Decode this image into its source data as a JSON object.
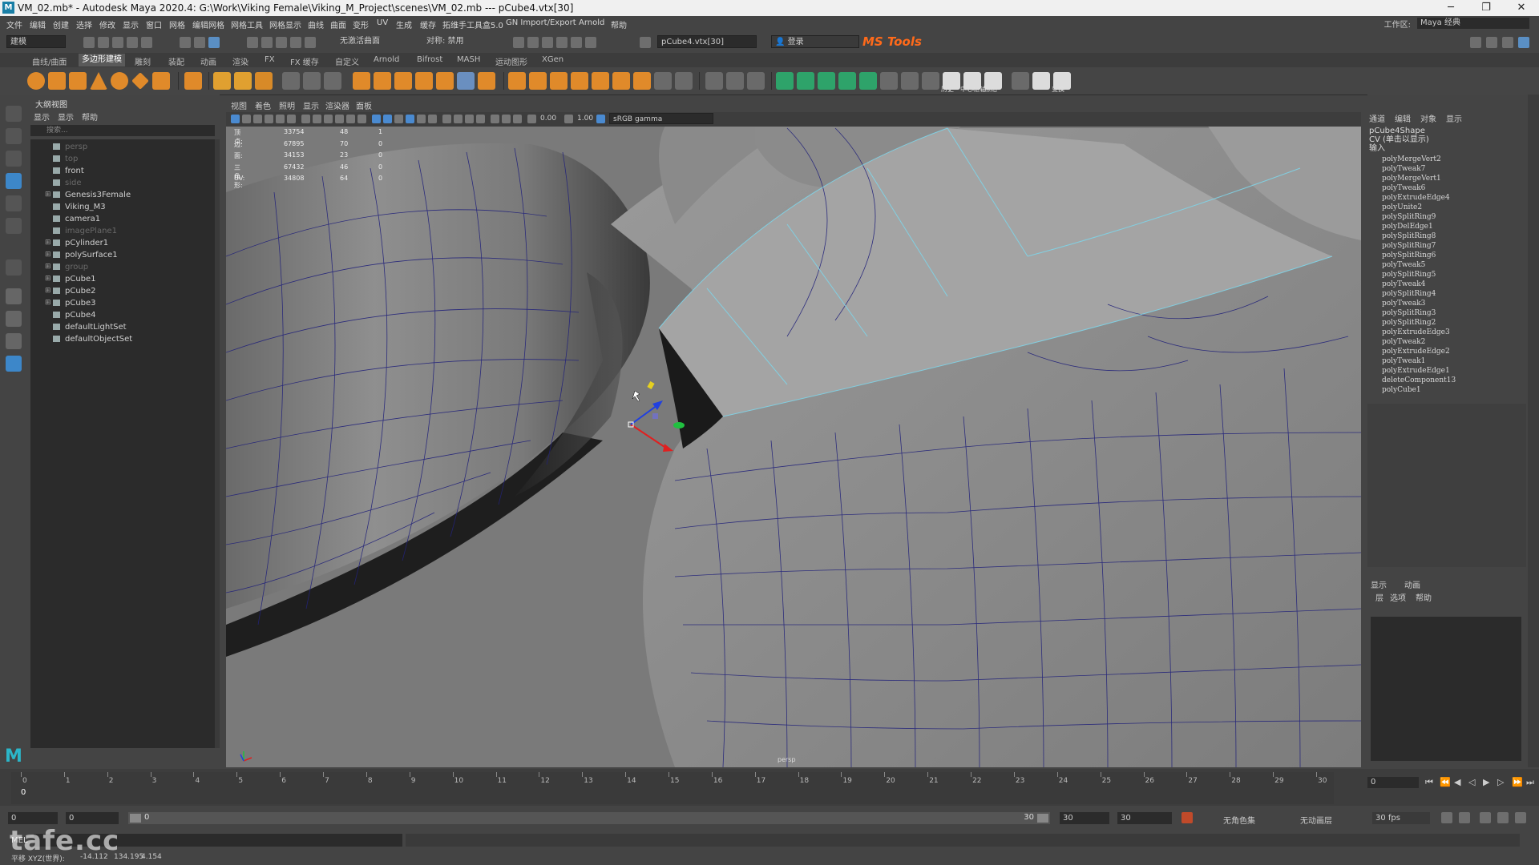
{
  "window": {
    "title": "VM_02.mb* - Autodesk Maya 2020.4: G:\\Work\\Viking Female\\Viking_M_Project\\scenes\\VM_02.mb   ---   pCube4.vtx[30]",
    "minimize": "─",
    "maximize": "❐",
    "close": "✕"
  },
  "menus": [
    "文件",
    "编辑",
    "创建",
    "选择",
    "修改",
    "显示",
    "窗口",
    "网格",
    "编辑网格",
    "网格工具",
    "网格显示",
    "曲线",
    "曲面",
    "变形",
    "UV",
    "生成",
    "缓存",
    "拓维手工具盒5.0",
    "GN Import/Export",
    "Arnold",
    "帮助"
  ],
  "workspace": {
    "label": "工作区:",
    "value": "Maya 经典"
  },
  "status": {
    "mode": "建模",
    "live_surface": "无激活曲面",
    "symmetry": "对称: 禁用",
    "selection_field": "pCube4.vtx[30]",
    "login": "登录",
    "mstools": "MS Tools"
  },
  "shelf_tabs": [
    "曲线/曲面",
    "多边形建模",
    "雕刻",
    "装配",
    "动画",
    "渲染",
    "FX",
    "FX 缓存",
    "自定义",
    "Arnold",
    "Bifrost",
    "MASH",
    "运动图形",
    "XGen"
  ],
  "shelf_active": "多边形建模",
  "shelf_text_labels": [
    "历史",
    "中心枢轴",
    "冻结",
    "变换"
  ],
  "outliner": {
    "title": "大纲视图",
    "menu": [
      "显示",
      "显示",
      "帮助"
    ],
    "search_placeholder": "搜索...",
    "items": [
      {
        "label": "persp",
        "dim": true,
        "expand": ""
      },
      {
        "label": "top",
        "dim": true,
        "expand": ""
      },
      {
        "label": "front",
        "dim": false,
        "expand": ""
      },
      {
        "label": "side",
        "dim": true,
        "expand": ""
      },
      {
        "label": "Genesis3Female",
        "dim": false,
        "expand": "⊞"
      },
      {
        "label": "Viking_M3",
        "dim": false,
        "expand": ""
      },
      {
        "label": "camera1",
        "dim": false,
        "expand": ""
      },
      {
        "label": "imagePlane1",
        "dim": true,
        "expand": ""
      },
      {
        "label": "pCylinder1",
        "dim": false,
        "expand": "⊞"
      },
      {
        "label": "polySurface1",
        "dim": false,
        "expand": "⊞"
      },
      {
        "label": "group",
        "dim": true,
        "expand": "⊞"
      },
      {
        "label": "pCube1",
        "dim": false,
        "expand": "⊞"
      },
      {
        "label": "pCube2",
        "dim": false,
        "expand": "⊞"
      },
      {
        "label": "pCube3",
        "dim": false,
        "expand": "⊞"
      },
      {
        "label": "pCube4",
        "dim": false,
        "expand": ""
      },
      {
        "label": "defaultLightSet",
        "dim": false,
        "expand": ""
      },
      {
        "label": "defaultObjectSet",
        "dim": false,
        "expand": ""
      }
    ]
  },
  "viewport": {
    "menu": [
      "视图",
      "着色",
      "照明",
      "显示",
      "渲染器",
      "面板"
    ],
    "exposure": "0.00",
    "gamma": "1.00",
    "color_space": "sRGB gamma",
    "camera_label": "persp",
    "stats": [
      {
        "label": "顶点:",
        "total": "33754",
        "sel": "48",
        "comp": "1"
      },
      {
        "label": "边:",
        "total": "67895",
        "sel": "70",
        "comp": "0"
      },
      {
        "label": "面:",
        "total": "34153",
        "sel": "23",
        "comp": "0"
      },
      {
        "label": "三角形:",
        "total": "67432",
        "sel": "46",
        "comp": "0"
      },
      {
        "label": "UV:",
        "total": "34808",
        "sel": "64",
        "comp": "0"
      }
    ]
  },
  "channel_box": {
    "tabs": [
      "通道",
      "编辑",
      "对象",
      "显示"
    ],
    "object": "pCube4Shape",
    "cv_label": "CV (单击以显示)",
    "inputs_label": "输入",
    "history": [
      "polyMergeVert2",
      "polyTweak7",
      "polyMergeVert1",
      "polyTweak6",
      "polyExtrudeEdge4",
      "polyUnite2",
      "polySplitRing9",
      "polyDelEdge1",
      "polySplitRing8",
      "polySplitRing7",
      "polySplitRing6",
      "polyTweak5",
      "polySplitRing5",
      "polyTweak4",
      "polySplitRing4",
      "polyTweak3",
      "polySplitRing3",
      "polySplitRing2",
      "polyExtrudeEdge3",
      "polyTweak2",
      "polyExtrudeEdge2",
      "polyTweak1",
      "polyExtrudeEdge1",
      "deleteComponent13",
      "polyCube1"
    ]
  },
  "layer_editor": {
    "tabs": [
      "显示",
      "动画"
    ],
    "menu": [
      "层",
      "选项",
      "帮助"
    ]
  },
  "timeline": {
    "ticks": [
      "0",
      "1",
      "2",
      "3",
      "4",
      "5",
      "6",
      "7",
      "8",
      "9",
      "10",
      "11",
      "12",
      "13",
      "14",
      "15",
      "16",
      "17",
      "18",
      "19",
      "20",
      "21",
      "22",
      "23",
      "24",
      "25",
      "26",
      "27",
      "28",
      "29",
      "30"
    ],
    "current_frame": "0",
    "current_field": "0"
  },
  "range": {
    "start": "0",
    "start2": "0",
    "handle_start": "0",
    "end_label": "30",
    "end": "30",
    "end2": "30",
    "character_set": "无角色集",
    "anim_layer": "无动画层",
    "fps": "30 fps"
  },
  "command": {
    "mel": "MEL"
  },
  "help_line": {
    "label": "平移 XYZ(世界):",
    "x": "-14.112",
    "y": "134.195",
    "z": "4.154"
  },
  "watermark": "tafe.cc",
  "colors": {
    "wire": "#1f1f7a",
    "highlight": "#7fd4e8",
    "manip_x": "#e02020",
    "manip_y": "#20c040",
    "manip_z": "#2040e0",
    "mstools": "#ff6a1a"
  }
}
